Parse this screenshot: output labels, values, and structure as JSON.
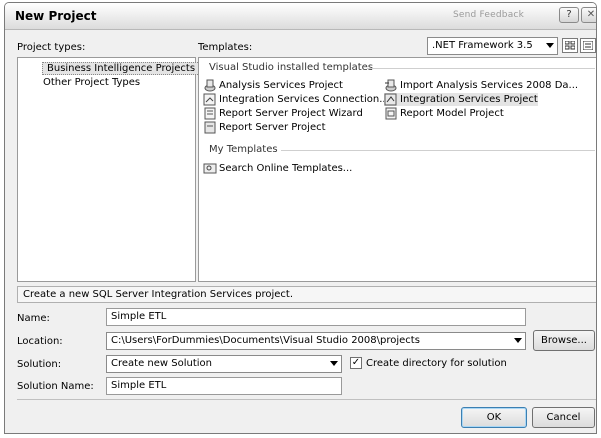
{
  "window": {
    "title": "New Project",
    "feedback": "Send Feedback",
    "help_glyph": "?",
    "close_glyph": "✕"
  },
  "project_types": {
    "label": "Project types:",
    "items": [
      {
        "label": "Business Intelligence Projects",
        "selected": true
      },
      {
        "label": "Other Project Types",
        "selected": false
      }
    ]
  },
  "templates": {
    "label": "Templates:",
    "framework": ".NET Framework 3.5",
    "installed_header": "Visual Studio installed templates",
    "installed": [
      {
        "label": "Analysis Services Project",
        "icon": "analysis-services-icon",
        "selected": false
      },
      {
        "label": "Import Analysis Services 2008 Da...",
        "icon": "import-analysis-icon",
        "selected": false
      },
      {
        "label": "Integration Services Connection...",
        "icon": "integration-connection-icon",
        "selected": false
      },
      {
        "label": "Integration Services Project",
        "icon": "integration-services-icon",
        "selected": true
      },
      {
        "label": "Report Server Project Wizard",
        "icon": "report-wizard-icon",
        "selected": false
      },
      {
        "label": "Report Model Project",
        "icon": "report-model-icon",
        "selected": false
      },
      {
        "label": "Report Server Project",
        "icon": "report-server-icon",
        "selected": false
      }
    ],
    "my_header": "My Templates",
    "my": [
      {
        "label": "Search Online Templates...",
        "icon": "search-online-icon"
      }
    ]
  },
  "description": "Create a new SQL Server Integration Services project.",
  "form": {
    "name_label": "Name:",
    "name_value": "Simple ETL",
    "location_label": "Location:",
    "location_value": "C:\\Users\\ForDummies\\Documents\\Visual Studio 2008\\projects",
    "browse_label": "Browse...",
    "solution_label": "Solution:",
    "solution_value": "Create new Solution",
    "create_dir_label": "Create directory for solution",
    "create_dir_checked": true,
    "solution_name_label": "Solution Name:",
    "solution_name_value": "Simple ETL"
  },
  "buttons": {
    "ok": "OK",
    "cancel": "Cancel"
  }
}
